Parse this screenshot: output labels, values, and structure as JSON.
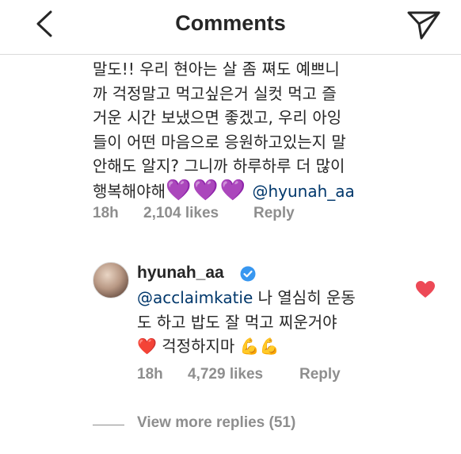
{
  "header": {
    "title": "Comments",
    "back_icon": "chevron-left-icon",
    "share_icon": "paper-plane-icon"
  },
  "comment": {
    "lines": [
      "말도!! 우리 현아는 살 좀 쪄도 예쁘니",
      "까 걱정말고 먹고싶은거 실컷 먹고 즐",
      "거운 시간 보냈으면 좋겠고, 우리 아잉",
      "들이 어떤 마음으로 응원하고있는지 말",
      "안해도 알지? 그니까 하루하루 더 많이"
    ],
    "last_line_text": "행복해야해",
    "hearts": "💜💜💜",
    "mention": "@hyunah_aa",
    "time": "18h",
    "likes": "2,104 likes",
    "reply_label": "Reply"
  },
  "reply": {
    "username": "hyunah_aa",
    "verified_icon": "verified-badge-icon",
    "mention": "@acclaimkatie",
    "text_part1": " 나 열심히 운동",
    "text_line2": "도 하고 밥도 잘 먹고 찌운거야",
    "red_heart": "❤️",
    "text_line3": " 걱정하지마 ",
    "muscles": "💪💪",
    "time": "18h",
    "likes": "4,729 likes",
    "reply_label": "Reply",
    "like_icon": "heart-filled-icon"
  },
  "view_more": "View more replies (51)",
  "colors": {
    "text": "#262626",
    "meta": "#8e8e8e",
    "mention": "#00376b",
    "like_red": "#ed4956",
    "verified_blue": "#3897f0"
  }
}
